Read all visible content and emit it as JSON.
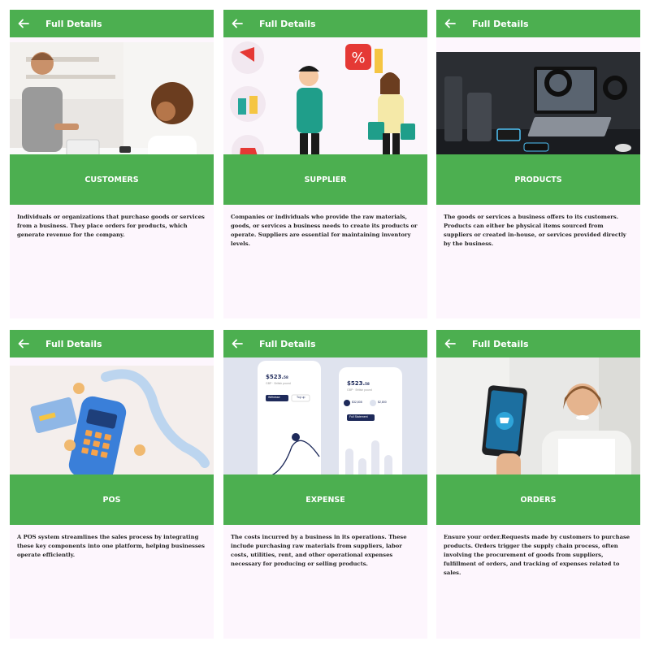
{
  "cards": [
    {
      "header_title": "Full Details",
      "label": "CUSTOMERS",
      "description": " Individuals or organizations that purchase goods or services from a business. They place orders for products, which generate revenue for the company."
    },
    {
      "header_title": "Full Details",
      "label": "SUPPLIER",
      "description": "Companies or individuals who provide the raw materials, goods, or services a business needs to create its products or operate. Suppliers are essential for maintaining inventory levels."
    },
    {
      "header_title": "Full Details",
      "label": "PRODUCTS",
      "description": "The goods or services a business offers to its customers. Products can either be physical items sourced from suppliers or created in-house, or services provided directly by the business."
    },
    {
      "header_title": "Full Details",
      "label": "POS",
      "description": "A POS system streamlines the sales process by integrating these key components into one platform, helping businesses operate efficiently."
    },
    {
      "header_title": "Full Details",
      "label": "EXPENSE",
      "description": "The costs incurred by a business in its operations. These include purchasing raw materials from suppliers, labor costs, utilities, rent, and other operational expenses necessary for producing or selling products."
    },
    {
      "header_title": "Full Details",
      "label": "ORDERS",
      "description": "Ensure your order.Requests made by customers to purchase products. Orders trigger the supply chain process, often involving the procurement of goods from suppliers, fulfillment of orders, and tracking of expenses related to sales."
    }
  ],
  "expense_mock": {
    "amount": "$523.",
    "amount_cents": "58",
    "subtitle": "GBP · British pound",
    "withdraw": "Withdraw",
    "topup": "Top up",
    "stat1": "$32,808",
    "stat2": "$2,800",
    "full_statement": "Full Statement"
  },
  "colors": {
    "header": "#4caf50",
    "band": "#4caf50",
    "card_bg": "#fdf6fd"
  },
  "icons": {
    "back": "arrow-left-icon"
  }
}
